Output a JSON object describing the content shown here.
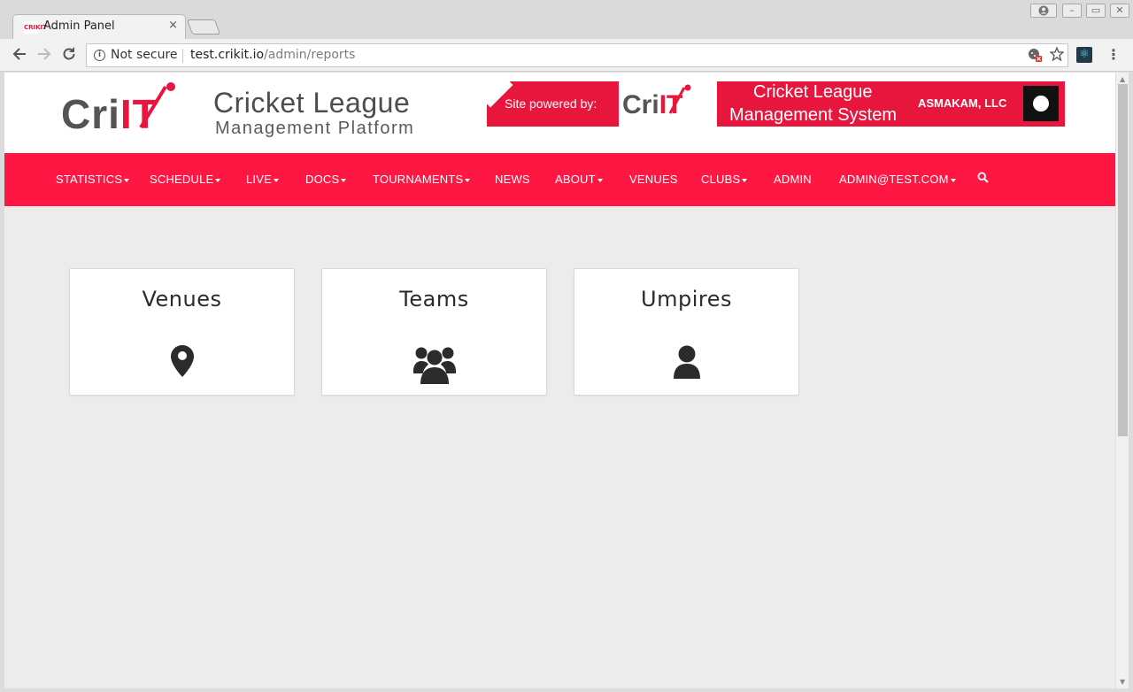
{
  "browser": {
    "tab_title": "Admin Panel",
    "tab_favicon": "CRIKIT",
    "tab_close": "×",
    "security_label": "Not secure",
    "url_host": "test.crikit.io",
    "url_path": "/admin/reports",
    "icons": [
      "back-icon",
      "forward-icon",
      "reload-icon",
      "info-icon",
      "blocked-cookie-icon",
      "star-icon",
      "react-devtools-icon",
      "menu-icon",
      "profile-icon",
      "minimize-icon",
      "maximize-icon",
      "close-icon"
    ]
  },
  "header": {
    "logo_cri": "Cri",
    "logo_it": "IT",
    "logo_title": "Cricket League",
    "logo_subtitle": "Management Platform",
    "banner": {
      "powered_by": "Site powered by:",
      "brand_cri": "Cri",
      "brand_it": "IT",
      "line1": "Cricket League",
      "line2": "Management System",
      "company": "ASMAKAM, LLC"
    }
  },
  "nav": {
    "items": [
      {
        "label": "STATISTICS",
        "dropdown": true
      },
      {
        "label": "SCHEDULE",
        "dropdown": true
      },
      {
        "label": "LIVE",
        "dropdown": true
      },
      {
        "label": "DOCS",
        "dropdown": true
      },
      {
        "label": "TOURNAMENTS",
        "dropdown": true
      },
      {
        "label": "NEWS",
        "dropdown": false
      },
      {
        "label": "ABOUT",
        "dropdown": true
      },
      {
        "label": "VENUES",
        "dropdown": false
      },
      {
        "label": "CLUBS",
        "dropdown": true
      },
      {
        "label": "ADMIN",
        "dropdown": false
      },
      {
        "label": "ADMIN@TEST.COM",
        "dropdown": true
      }
    ],
    "search_icon": "search-icon"
  },
  "cards": [
    {
      "title": "Venues",
      "icon": "map-marker-icon"
    },
    {
      "title": "Teams",
      "icon": "users-icon"
    },
    {
      "title": "Umpires",
      "icon": "user-icon"
    }
  ],
  "colors": {
    "brand_red": "#ff1744",
    "logo_red": "#e8163d",
    "page_bg": "#ececec",
    "card_bg": "#ffffff",
    "text_dark": "#2b2b2b"
  }
}
